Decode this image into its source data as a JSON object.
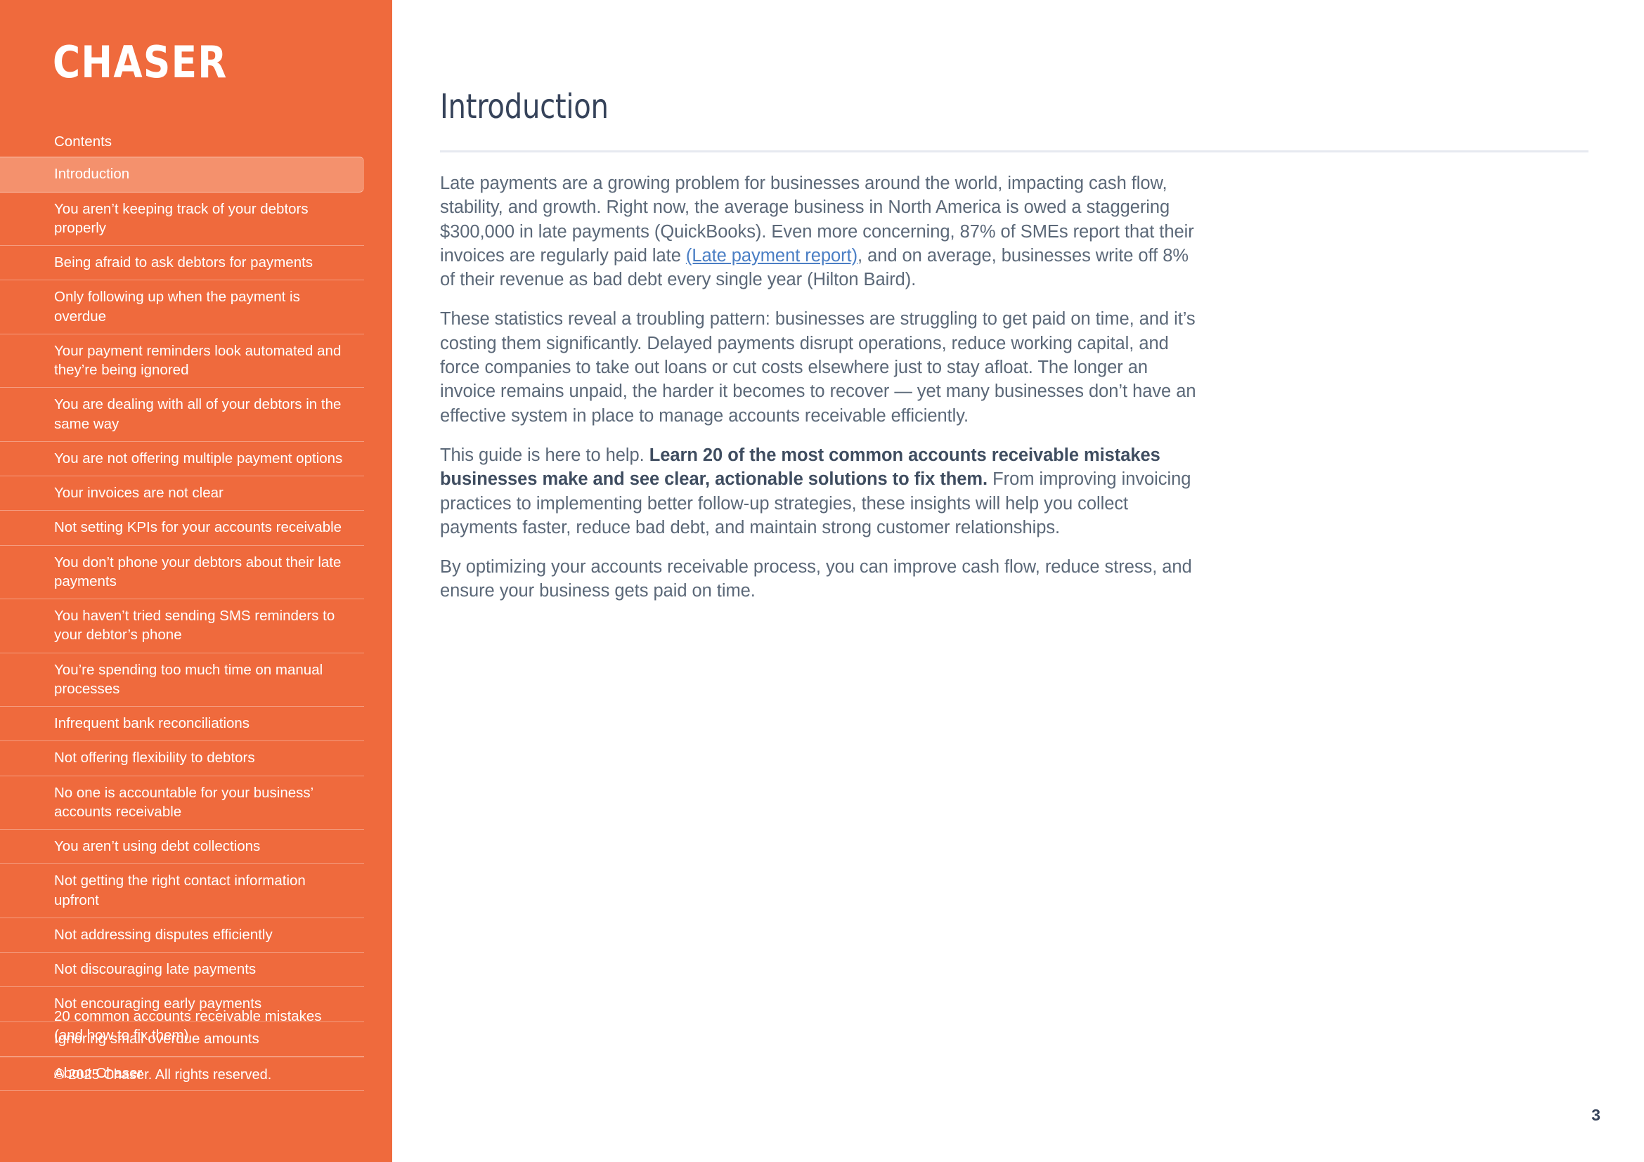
{
  "theme": {
    "sidebar_bg": "#ef6a3d",
    "sidebar_active_bg": "#f4916d",
    "heading_color": "#36435a",
    "body_color": "#5b6878",
    "link_color": "#4a7ec4",
    "rule_color": "#e6e9f0"
  },
  "sidebar": {
    "logo": "CHASER",
    "contents_heading": "Contents",
    "items": [
      {
        "label": "Introduction",
        "active": true
      },
      {
        "label": "You aren’t keeping track of your debtors properly",
        "active": false
      },
      {
        "label": "Being afraid to ask debtors for payments",
        "active": false
      },
      {
        "label": "Only following up when the payment is overdue",
        "active": false
      },
      {
        "label": "Your payment reminders look automated and they’re being ignored",
        "active": false
      },
      {
        "label": "You are dealing with all of your debtors in the same way",
        "active": false
      },
      {
        "label": "You are not offering multiple payment options",
        "active": false
      },
      {
        "label": "Your invoices are not clear",
        "active": false
      },
      {
        "label": "Not setting KPIs for your accounts receivable",
        "active": false
      },
      {
        "label": "You don’t phone your debtors about their late payments",
        "active": false
      },
      {
        "label": "You haven’t tried sending SMS reminders to your debtor’s phone",
        "active": false
      },
      {
        "label": "You’re spending too much time on manual processes",
        "active": false
      },
      {
        "label": "Infrequent bank reconciliations",
        "active": false
      },
      {
        "label": "Not offering flexibility to debtors",
        "active": false
      },
      {
        "label": "No one is accountable for your business’ accounts receivable",
        "active": false
      },
      {
        "label": "You aren’t using debt collections",
        "active": false
      },
      {
        "label": "Not getting the right contact information upfront",
        "active": false
      },
      {
        "label": "Not addressing disputes efficiently",
        "active": false
      },
      {
        "label": "Not discouraging late payments",
        "active": false
      },
      {
        "label": "Not encouraging early payments",
        "active": false
      },
      {
        "label": "Ignoring small overdue amounts",
        "active": false
      },
      {
        "label": "About Chaser",
        "active": false
      }
    ],
    "document_title": "20 common accounts receivable mistakes (and how to fix them)",
    "copyright": "© 2025 Chaser. All rights reserved."
  },
  "main": {
    "title": "Introduction",
    "paragraphs": [
      {
        "id": "p1",
        "segments": [
          {
            "type": "text",
            "value": "Late payments are a growing problem for businesses around the world, impacting cash flow, stability, and growth. Right now, the average business in North America is owed a staggering $300,000 in late payments (QuickBooks). Even more concerning, 87% of SMEs report that their invoices are regularly paid late "
          },
          {
            "type": "link",
            "value": "(Late payment report)"
          },
          {
            "type": "text",
            "value": ", and on average, businesses write off 8% of their revenue as bad debt every single year (Hilton Baird)."
          }
        ]
      },
      {
        "id": "p2",
        "segments": [
          {
            "type": "text",
            "value": "These statistics reveal a troubling pattern: businesses are struggling to get paid on time, and it’s costing them significantly. Delayed payments disrupt operations, reduce working capital, and force companies to take out loans or cut costs elsewhere just to stay afloat. The longer an invoice remains unpaid, the harder it becomes to recover — yet many businesses don’t have an effective system in place to manage accounts receivable efficiently."
          }
        ]
      },
      {
        "id": "p3",
        "segments": [
          {
            "type": "text",
            "value": "This guide is here to help. "
          },
          {
            "type": "bold",
            "value": "Learn 20 of the most common accounts receivable mistakes businesses make and see clear, actionable solutions to fix them."
          },
          {
            "type": "text",
            "value": " From improving invoicing practices to implementing better follow-up strategies, these insights will help you collect payments faster, reduce bad debt, and maintain strong customer relationships."
          }
        ]
      },
      {
        "id": "p4",
        "segments": [
          {
            "type": "text",
            "value": "By optimizing your accounts receivable process, you can improve cash flow, reduce stress, and ensure your business gets paid on time."
          }
        ]
      }
    ],
    "page_number": "3"
  }
}
